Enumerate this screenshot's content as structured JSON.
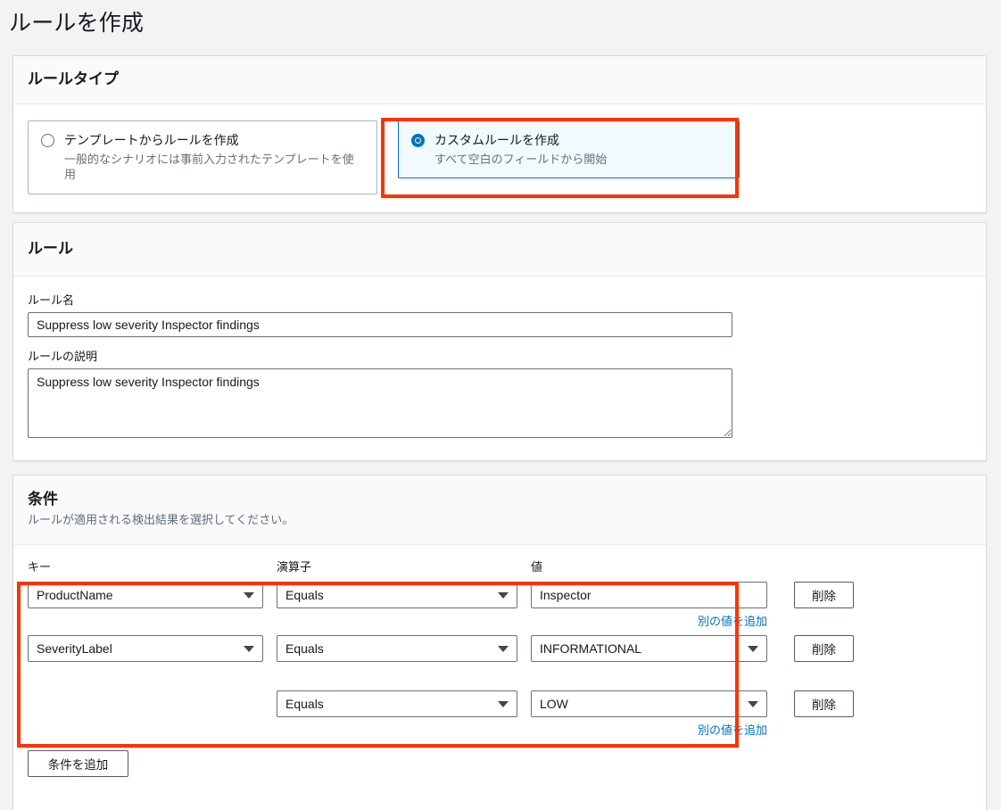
{
  "page": {
    "title": "ルールを作成"
  },
  "rule_type": {
    "heading": "ルールタイプ",
    "options": [
      {
        "label": "テンプレートからルールを作成",
        "description": "一般的なシナリオには事前入力されたテンプレートを使用",
        "selected": false
      },
      {
        "label": "カスタムルールを作成",
        "description": "すべて空白のフィールドから開始",
        "selected": true
      }
    ]
  },
  "rule": {
    "heading": "ルール",
    "name_label": "ルール名",
    "name_value": "Suppress low severity Inspector findings",
    "name_placeholder": "",
    "description_label": "ルールの説明",
    "description_value": "Suppress low severity Inspector findings",
    "description_placeholder": ""
  },
  "conditions": {
    "heading": "条件",
    "subheading": "ルールが適用される検出結果を選択してください。",
    "columns": {
      "key": "キー",
      "operator": "演算子",
      "value": "値"
    },
    "add_value_link": "別の値を追加",
    "delete_label": "削除",
    "add_condition_label": "条件を追加",
    "rows": [
      {
        "key": "ProductName",
        "key_type": "select",
        "operator": "Equals",
        "value": "Inspector",
        "value_type": "text",
        "has_add_value_link": true,
        "delete": "削除"
      },
      {
        "key": "SeverityLabel",
        "key_type": "select",
        "operator": "Equals",
        "value": "INFORMATIONAL",
        "value_type": "select",
        "has_add_value_link": false,
        "delete": "削除"
      },
      {
        "key": "",
        "key_type": "empty",
        "operator": "Equals",
        "value": "LOW",
        "value_type": "select",
        "has_add_value_link": true,
        "delete": "削除"
      }
    ]
  },
  "colors": {
    "accent_blue": "#0073bb",
    "highlight_red": "#ff3300",
    "page_background": "#f2f3f3",
    "card_background": "#ffffff",
    "header_background": "#fafafa",
    "selected_tile_background": "#f1faff"
  }
}
